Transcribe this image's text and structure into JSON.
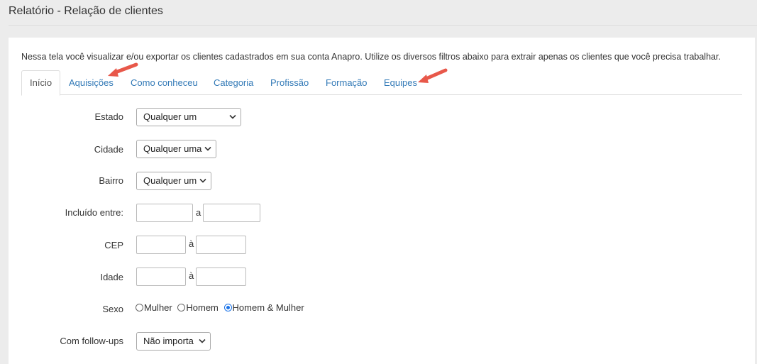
{
  "header": {
    "title": "Relatório - Relação de clientes"
  },
  "intro": "Nessa tela você visualizar e/ou exportar os clientes cadastrados em sua conta Anapro. Utilize os diversos filtros abaixo para extrair apenas os clientes que você precisa trabalhar.",
  "tabs": [
    {
      "label": "Início",
      "active": true
    },
    {
      "label": "Aquisições"
    },
    {
      "label": "Como conheceu"
    },
    {
      "label": "Categoria"
    },
    {
      "label": "Profissão"
    },
    {
      "label": "Formação"
    },
    {
      "label": "Equipes"
    }
  ],
  "filters": {
    "estado": {
      "label": "Estado",
      "value": "Qualquer um"
    },
    "cidade": {
      "label": "Cidade",
      "value": "Qualquer uma"
    },
    "bairro": {
      "label": "Bairro",
      "value": "Qualquer um"
    },
    "incluido": {
      "label": "Incluído entre:",
      "from": "",
      "separator": "a",
      "to": ""
    },
    "cep": {
      "label": "CEP",
      "from": "",
      "separator": "à",
      "to": ""
    },
    "idade": {
      "label": "Idade",
      "from": "",
      "separator": "à",
      "to": ""
    },
    "sexo": {
      "label": "Sexo",
      "options": [
        "Mulher",
        "Homem",
        "Homem & Mulher"
      ],
      "selected": "Homem & Mulher"
    },
    "followups": {
      "label": "Com follow-ups",
      "value": "Não importa"
    }
  },
  "annotations": {
    "arrow_color": "#e8584a"
  }
}
